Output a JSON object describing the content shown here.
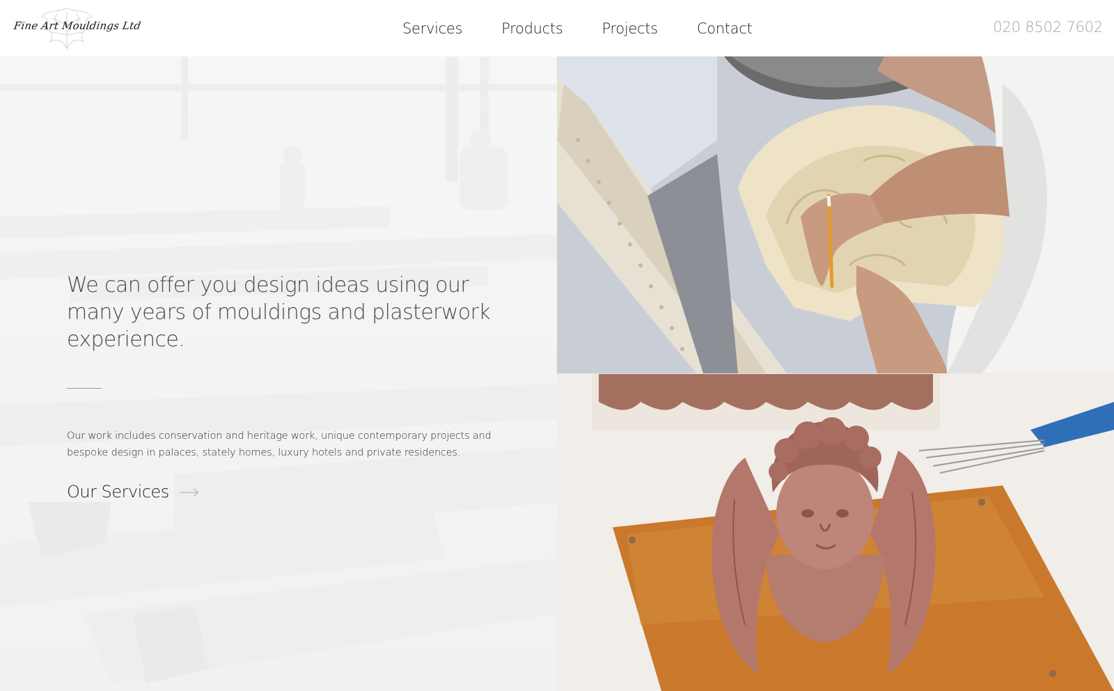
{
  "header": {
    "logo_text": "Fine Art Mouldings Ltd",
    "nav": [
      {
        "label": "Services"
      },
      {
        "label": "Products"
      },
      {
        "label": "Projects"
      },
      {
        "label": "Contact"
      }
    ],
    "phone": "020 8502 7602"
  },
  "hero": {
    "headline": "We can offer you design ideas using our many years of mouldings and plasterwork experience.",
    "body": "Our work includes conservation and heritage work, unique contemporary projects and bespoke design in palaces, stately homes, luxury hotels and private residences.",
    "cta_label": "Our Services",
    "cta_icon": "arrow-right-icon"
  },
  "photos": [
    {
      "subject": "craftsman marking an ornate plaster moulding with a pencil"
    },
    {
      "subject": "terracotta cherub bust with wings on a wooden board"
    }
  ],
  "colors": {
    "nav_text": "#1a1a1a",
    "phone_text": "#a3a3a3",
    "headline_text": "#4a4a4a",
    "hero_background": "#f4f4f4"
  }
}
